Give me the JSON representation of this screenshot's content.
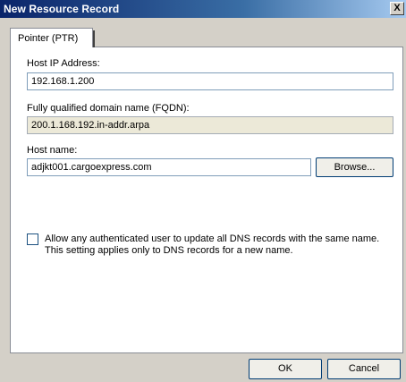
{
  "window": {
    "title": "New Resource Record",
    "close_glyph": "X"
  },
  "tab": {
    "label": "Pointer (PTR)"
  },
  "form": {
    "host_ip_label": "Host IP Address:",
    "host_ip_value": "192.168.1.200",
    "fqdn_label": "Fully qualified domain name (FQDN):",
    "fqdn_value": "200.1.168.192.in-addr.arpa",
    "hostname_label": "Host name:",
    "hostname_value": "adjkt001.cargoexpress.com",
    "browse_label": "Browse...",
    "allow_update_checked": false,
    "allow_update_label": "Allow any authenticated user to update all DNS records with the same name. This setting applies only to DNS records for a new name."
  },
  "buttons": {
    "ok_label": "OK",
    "cancel_label": "Cancel"
  }
}
